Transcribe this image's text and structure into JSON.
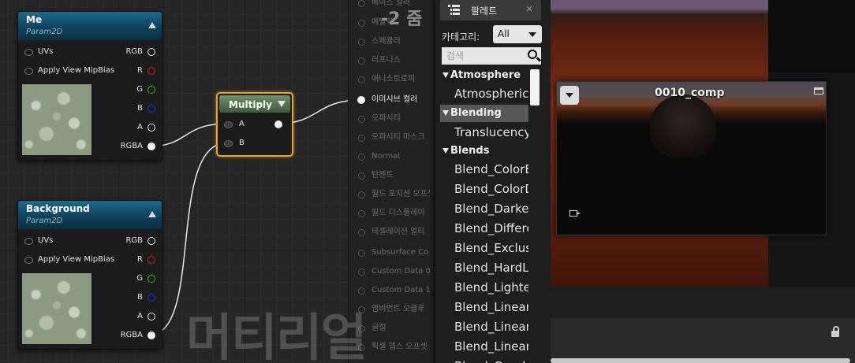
{
  "graph": {
    "zoom_label": "-2 줌",
    "watermark": "머티리얼"
  },
  "nodes": {
    "me": {
      "title": "Me",
      "subtitle": "Param2D",
      "inputs": [
        "UVs",
        "Apply View MipBias"
      ],
      "outputs": [
        "RGB",
        "R",
        "G",
        "B",
        "A",
        "RGBA"
      ]
    },
    "background": {
      "title": "Background",
      "subtitle": "Param2D",
      "inputs": [
        "UVs",
        "Apply View MipBias"
      ],
      "outputs": [
        "RGB",
        "R",
        "G",
        "B",
        "A",
        "RGBA"
      ]
    },
    "multiply": {
      "title": "Multiply",
      "inputs": [
        "A",
        "B"
      ]
    }
  },
  "result_node": {
    "pins": [
      "베이스 컬러",
      "메탈릭",
      "스페큘러",
      "러프니스",
      "애니소트로피",
      "이미시브 컬러",
      "오파시티",
      "오파시티 마스크",
      "Normal",
      "탄젠트",
      "월드 포지션 오프셋",
      "월드 디스플레이",
      "테셀레이션 멀티",
      "Subsurface Co",
      "Custom Data 0",
      "Custom Data 1",
      "앰비언트 오클루",
      "굴절",
      "픽셀 뎁스 오프셋"
    ],
    "active_index": 5
  },
  "palette": {
    "tab_title": "팔레트",
    "category_label": "카테고리:",
    "category_value": "All",
    "search_placeholder": "검색",
    "categories": [
      {
        "name": "Atmosphere",
        "items": [
          "AtmosphericFog"
        ]
      },
      {
        "name": "Blending",
        "items": [
          "TranslucencyBlend"
        ],
        "selected": true
      },
      {
        "name": "Blends",
        "items": [
          "Blend_ColorBurn",
          "Blend_ColorDodge",
          "Blend_Darken",
          "Blend_Difference",
          "Blend_Exclusion",
          "Blend_HardLight",
          "Blend_LightenLight",
          "Blend_LinearBurn",
          "Blend_LinearDodge",
          "Blend_LinearLight",
          "Blend_Overlay"
        ]
      }
    ]
  },
  "viewport": {
    "comp_title": "0010_comp"
  },
  "colors": {
    "node_header": "#0e3f57",
    "multiply_header": "#4f6d4b",
    "selection": "#e9a22b",
    "pin_r": "#e02020",
    "pin_g": "#22c222",
    "pin_b": "#2030e0"
  }
}
